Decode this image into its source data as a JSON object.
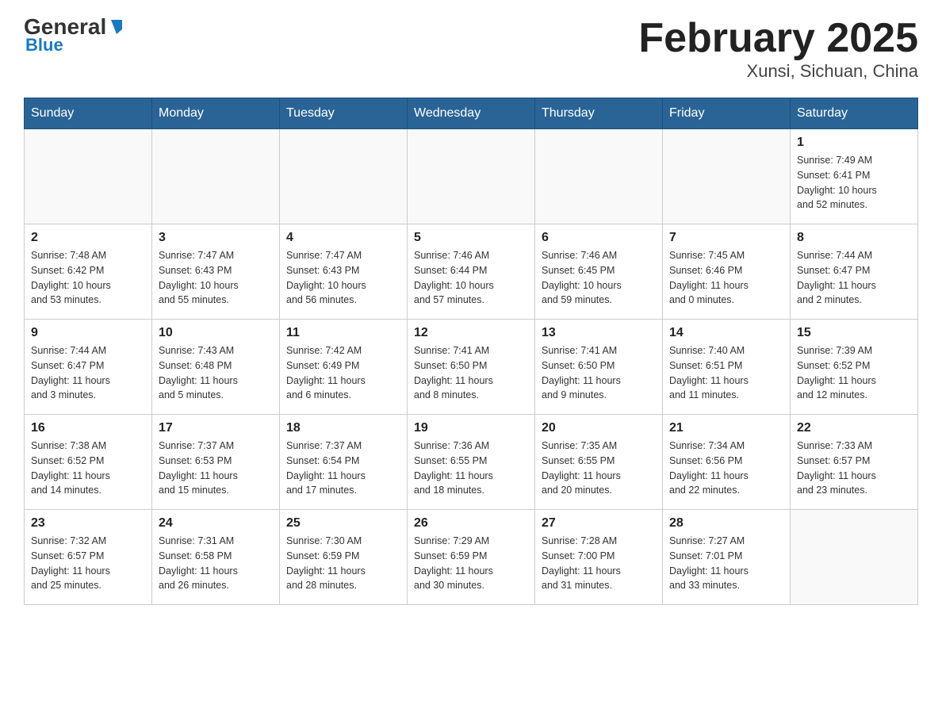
{
  "logo": {
    "general": "General",
    "blue": "Blue"
  },
  "title": "February 2025",
  "subtitle": "Xunsi, Sichuan, China",
  "days_of_week": [
    "Sunday",
    "Monday",
    "Tuesday",
    "Wednesday",
    "Thursday",
    "Friday",
    "Saturday"
  ],
  "weeks": [
    [
      {
        "day": "",
        "info": ""
      },
      {
        "day": "",
        "info": ""
      },
      {
        "day": "",
        "info": ""
      },
      {
        "day": "",
        "info": ""
      },
      {
        "day": "",
        "info": ""
      },
      {
        "day": "",
        "info": ""
      },
      {
        "day": "1",
        "info": "Sunrise: 7:49 AM\nSunset: 6:41 PM\nDaylight: 10 hours\nand 52 minutes."
      }
    ],
    [
      {
        "day": "2",
        "info": "Sunrise: 7:48 AM\nSunset: 6:42 PM\nDaylight: 10 hours\nand 53 minutes."
      },
      {
        "day": "3",
        "info": "Sunrise: 7:47 AM\nSunset: 6:43 PM\nDaylight: 10 hours\nand 55 minutes."
      },
      {
        "day": "4",
        "info": "Sunrise: 7:47 AM\nSunset: 6:43 PM\nDaylight: 10 hours\nand 56 minutes."
      },
      {
        "day": "5",
        "info": "Sunrise: 7:46 AM\nSunset: 6:44 PM\nDaylight: 10 hours\nand 57 minutes."
      },
      {
        "day": "6",
        "info": "Sunrise: 7:46 AM\nSunset: 6:45 PM\nDaylight: 10 hours\nand 59 minutes."
      },
      {
        "day": "7",
        "info": "Sunrise: 7:45 AM\nSunset: 6:46 PM\nDaylight: 11 hours\nand 0 minutes."
      },
      {
        "day": "8",
        "info": "Sunrise: 7:44 AM\nSunset: 6:47 PM\nDaylight: 11 hours\nand 2 minutes."
      }
    ],
    [
      {
        "day": "9",
        "info": "Sunrise: 7:44 AM\nSunset: 6:47 PM\nDaylight: 11 hours\nand 3 minutes."
      },
      {
        "day": "10",
        "info": "Sunrise: 7:43 AM\nSunset: 6:48 PM\nDaylight: 11 hours\nand 5 minutes."
      },
      {
        "day": "11",
        "info": "Sunrise: 7:42 AM\nSunset: 6:49 PM\nDaylight: 11 hours\nand 6 minutes."
      },
      {
        "day": "12",
        "info": "Sunrise: 7:41 AM\nSunset: 6:50 PM\nDaylight: 11 hours\nand 8 minutes."
      },
      {
        "day": "13",
        "info": "Sunrise: 7:41 AM\nSunset: 6:50 PM\nDaylight: 11 hours\nand 9 minutes."
      },
      {
        "day": "14",
        "info": "Sunrise: 7:40 AM\nSunset: 6:51 PM\nDaylight: 11 hours\nand 11 minutes."
      },
      {
        "day": "15",
        "info": "Sunrise: 7:39 AM\nSunset: 6:52 PM\nDaylight: 11 hours\nand 12 minutes."
      }
    ],
    [
      {
        "day": "16",
        "info": "Sunrise: 7:38 AM\nSunset: 6:52 PM\nDaylight: 11 hours\nand 14 minutes."
      },
      {
        "day": "17",
        "info": "Sunrise: 7:37 AM\nSunset: 6:53 PM\nDaylight: 11 hours\nand 15 minutes."
      },
      {
        "day": "18",
        "info": "Sunrise: 7:37 AM\nSunset: 6:54 PM\nDaylight: 11 hours\nand 17 minutes."
      },
      {
        "day": "19",
        "info": "Sunrise: 7:36 AM\nSunset: 6:55 PM\nDaylight: 11 hours\nand 18 minutes."
      },
      {
        "day": "20",
        "info": "Sunrise: 7:35 AM\nSunset: 6:55 PM\nDaylight: 11 hours\nand 20 minutes."
      },
      {
        "day": "21",
        "info": "Sunrise: 7:34 AM\nSunset: 6:56 PM\nDaylight: 11 hours\nand 22 minutes."
      },
      {
        "day": "22",
        "info": "Sunrise: 7:33 AM\nSunset: 6:57 PM\nDaylight: 11 hours\nand 23 minutes."
      }
    ],
    [
      {
        "day": "23",
        "info": "Sunrise: 7:32 AM\nSunset: 6:57 PM\nDaylight: 11 hours\nand 25 minutes."
      },
      {
        "day": "24",
        "info": "Sunrise: 7:31 AM\nSunset: 6:58 PM\nDaylight: 11 hours\nand 26 minutes."
      },
      {
        "day": "25",
        "info": "Sunrise: 7:30 AM\nSunset: 6:59 PM\nDaylight: 11 hours\nand 28 minutes."
      },
      {
        "day": "26",
        "info": "Sunrise: 7:29 AM\nSunset: 6:59 PM\nDaylight: 11 hours\nand 30 minutes."
      },
      {
        "day": "27",
        "info": "Sunrise: 7:28 AM\nSunset: 7:00 PM\nDaylight: 11 hours\nand 31 minutes."
      },
      {
        "day": "28",
        "info": "Sunrise: 7:27 AM\nSunset: 7:01 PM\nDaylight: 11 hours\nand 33 minutes."
      },
      {
        "day": "",
        "info": ""
      }
    ]
  ]
}
